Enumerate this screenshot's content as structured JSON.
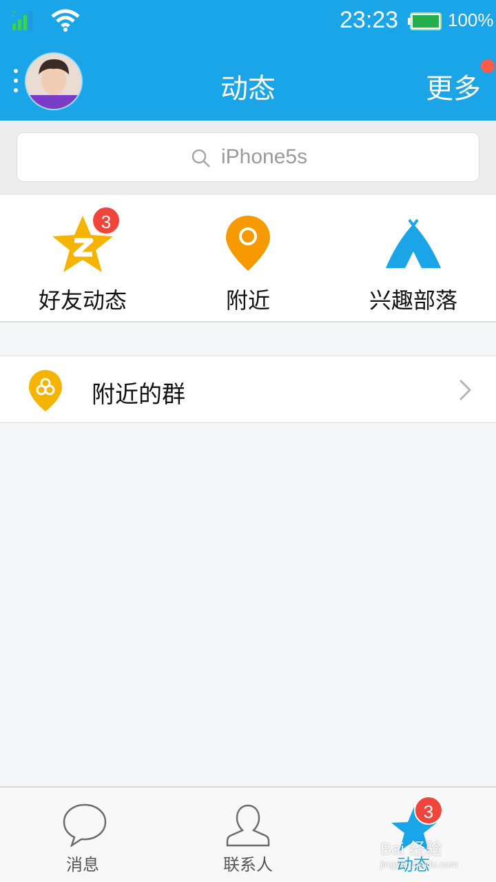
{
  "status_bar": {
    "time": "23:23",
    "battery_percent": "100%",
    "icons": [
      "signal-icon",
      "wifi-icon",
      "battery-icon"
    ]
  },
  "header": {
    "title": "动态",
    "more_label": "更多",
    "icons": [
      "menu-dots-icon",
      "avatar"
    ]
  },
  "search": {
    "placeholder": "iPhone5s"
  },
  "quick_actions": [
    {
      "label": "好友动态",
      "icon": "star-z-icon",
      "badge": "3"
    },
    {
      "label": "附近",
      "icon": "location-pin-icon"
    },
    {
      "label": "兴趣部落",
      "icon": "tent-icon"
    }
  ],
  "list": {
    "nearby_groups_label": "附近的群",
    "icon": "group-pin-icon"
  },
  "tabbar": {
    "tabs": [
      {
        "label": "消息",
        "icon": "chat-bubble-icon"
      },
      {
        "label": "联系人",
        "icon": "contact-person-icon"
      },
      {
        "label": "动态",
        "icon": "star-icon",
        "badge": "3",
        "active": true
      }
    ]
  },
  "watermark": {
    "text": "Bai 经验",
    "sub": "jingyan.baidu.com"
  },
  "colors": {
    "primary": "#1aa5e8",
    "badge": "#f0453a",
    "star_yellow": "#f5b400",
    "pin_orange": "#f79a00"
  }
}
